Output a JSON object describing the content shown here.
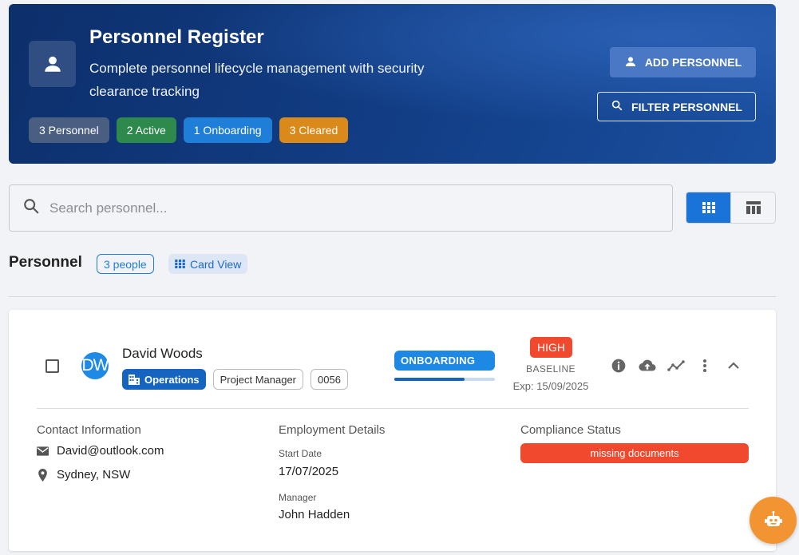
{
  "header": {
    "title": "Personnel Register",
    "subtitle": "Complete personnel lifecycle management with security clearance tracking",
    "stats": [
      {
        "label": "3 Personnel",
        "color": "#4a5e82"
      },
      {
        "label": "2 Active",
        "color": "#2e8a4c"
      },
      {
        "label": "1 Onboarding",
        "color": "#1f7ed8"
      },
      {
        "label": "3 Cleared",
        "color": "#d98a1b"
      }
    ],
    "add_label": "ADD PERSONNEL",
    "filter_label": "FILTER PERSONNEL"
  },
  "search": {
    "placeholder": "Search personnel..."
  },
  "section": {
    "title": "Personnel",
    "count": "3 people",
    "view_label": "Card View"
  },
  "card": {
    "initials": "DW",
    "name": "David Woods",
    "department": "Operations",
    "role": "Project Manager",
    "id": "0056",
    "status": "ONBOARDING",
    "progress": 0.7,
    "risk": "HIGH",
    "clearance": "BASELINE",
    "expiry": "Exp: 15/09/2025",
    "contact": {
      "title": "Contact Information",
      "email": "David@outlook.com",
      "location": "Sydney, NSW"
    },
    "employment": {
      "title": "Employment Details",
      "start_label": "Start Date",
      "start_value": "17/07/2025",
      "manager_label": "Manager",
      "manager_value": "John Hadden"
    },
    "compliance": {
      "title": "Compliance Status",
      "value": "missing documents"
    }
  },
  "colors": {
    "accent": "#1f7ed8",
    "danger": "#f0492e",
    "fab": "#f39433"
  }
}
